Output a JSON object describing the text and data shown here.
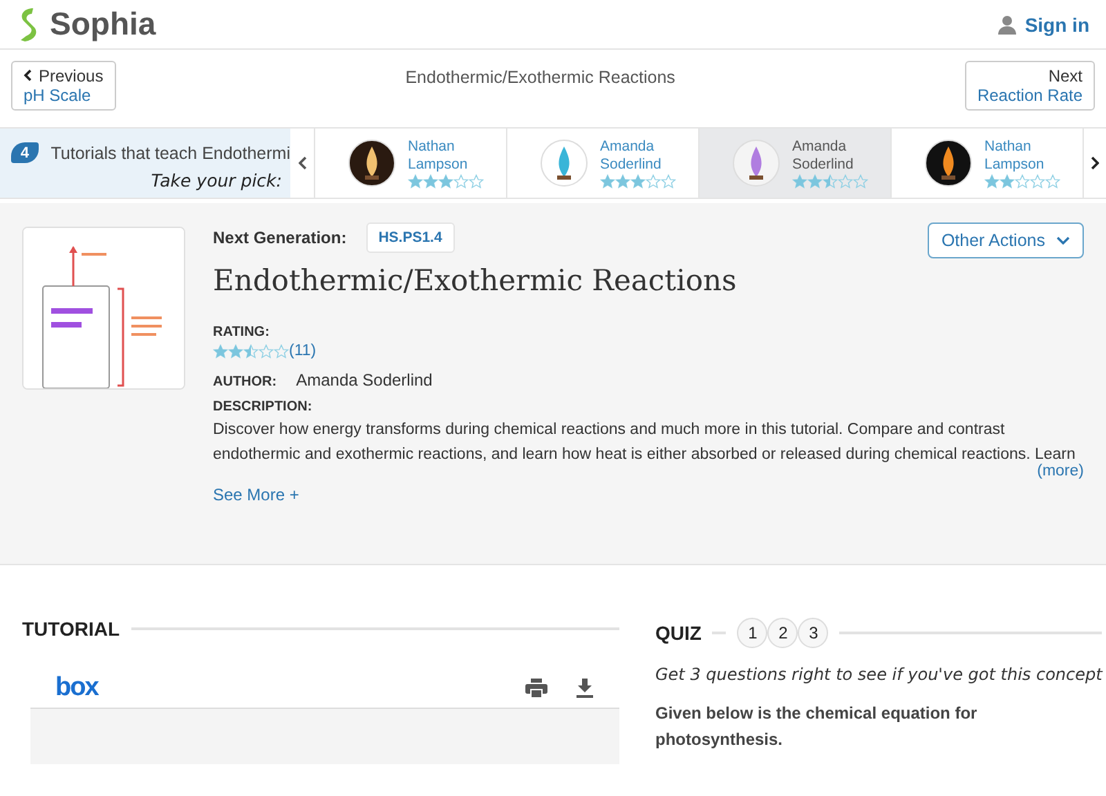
{
  "header": {
    "logo": "Sophia",
    "sign_in": "Sign in"
  },
  "nav": {
    "previous": {
      "label": "Previous",
      "target": "pH Scale"
    },
    "title": "Endothermic/Exothermic Reactions",
    "next": {
      "label": "Next",
      "target": "Reaction Rate"
    }
  },
  "carousel": {
    "count": "4",
    "heading": "Tutorials that teach Endothermi",
    "tagline": "Take your pick:",
    "cards": [
      {
        "author": "Nathan Lampson",
        "stars": 3,
        "selected": false,
        "kind": "picture"
      },
      {
        "author": "Amanda Soderlind",
        "stars": 3,
        "selected": false,
        "kind": "picture"
      },
      {
        "author": "Amanda Soderlind",
        "stars": 2.5,
        "selected": true,
        "kind": "picture"
      },
      {
        "author": "Nathan Lampson",
        "stars": 2,
        "selected": false,
        "kind": "picture"
      }
    ]
  },
  "details": {
    "standard_label": "Next Generation:",
    "standard": "HS.PS1.4",
    "actions": "Other Actions",
    "title": "Endothermic/Exothermic Reactions",
    "rating_label": "RATING:",
    "stars": 2.5,
    "rating_count": "(11)",
    "author_label": "AUTHOR:",
    "author": "Amanda Soderlind",
    "description_label": "DESCRIPTION:",
    "description": "Discover how energy transforms during chemical reactions and much more in this tutorial.  Compare and contrast endothermic and exothermic reactions, and learn how heat is either absorbed or released during chemical reactions. Learn",
    "more": "(more)",
    "see_more": "See More +"
  },
  "tutorial": {
    "heading": "TUTORIAL",
    "viewer_logo": "box"
  },
  "quiz": {
    "heading": "QUIZ",
    "steps": [
      "1",
      "2",
      "3"
    ],
    "tagline": "Get 3 questions right to see if you've got this concept",
    "question": "Given below is the chemical equation for photosynthesis."
  }
}
